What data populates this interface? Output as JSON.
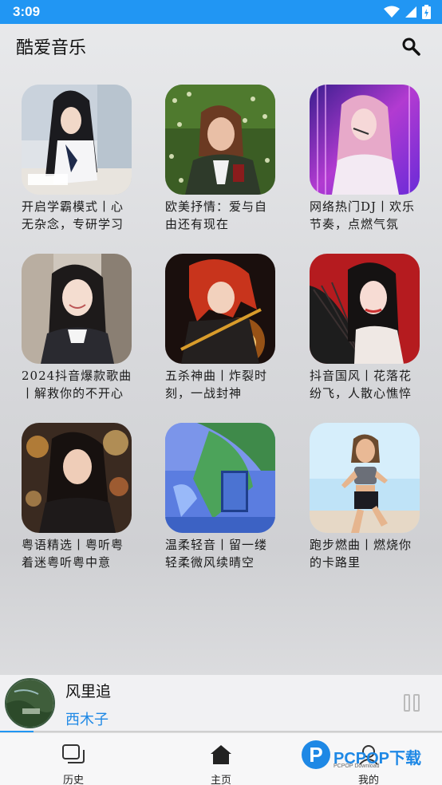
{
  "status_bar": {
    "time": "3:09"
  },
  "header": {
    "title": "酷爱音乐"
  },
  "playlists": [
    {
      "title": "开启学霸模式丨心无杂念，专研学习",
      "cover": "cover-girl-studying"
    },
    {
      "title": "欧美抒情：爱与自由还有现在",
      "cover": "cover-woman-in-field"
    },
    {
      "title": "网络热门DJ丨欢乐节奏，点燃气氛",
      "cover": "cover-dj-singer"
    },
    {
      "title": "2024抖音爆款歌曲丨解救你的不开心",
      "cover": "cover-smiling-girl"
    },
    {
      "title": "五杀神曲丨炸裂时刻，一战封神",
      "cover": "cover-anime-warrior"
    },
    {
      "title": "抖音国风丨花落花纷飞，人散心憔悴",
      "cover": "cover-fan-girl"
    },
    {
      "title": "粤语精选丨粤听粤着迷粤听粤中意",
      "cover": "cover-night-lights-girl"
    },
    {
      "title": "温柔轻音丨留一缕轻柔微风续晴空",
      "cover": "cover-painted-window"
    },
    {
      "title": "跑步燃曲丨燃烧你的卡路里",
      "cover": "cover-runner"
    }
  ],
  "player": {
    "song": "风里追",
    "artist": "西木子",
    "progress": 0.076
  },
  "bottom_nav": [
    {
      "label": "历史",
      "icon": "history-icon"
    },
    {
      "label": "主页",
      "icon": "home-icon"
    },
    {
      "label": "我的",
      "icon": "profile-icon"
    }
  ],
  "watermark": {
    "letter": "P",
    "text": "PCPOP下载",
    "sub": "PCPOP Download"
  },
  "colors": {
    "accent": "#2196f3",
    "artist": "#1e88e5"
  }
}
